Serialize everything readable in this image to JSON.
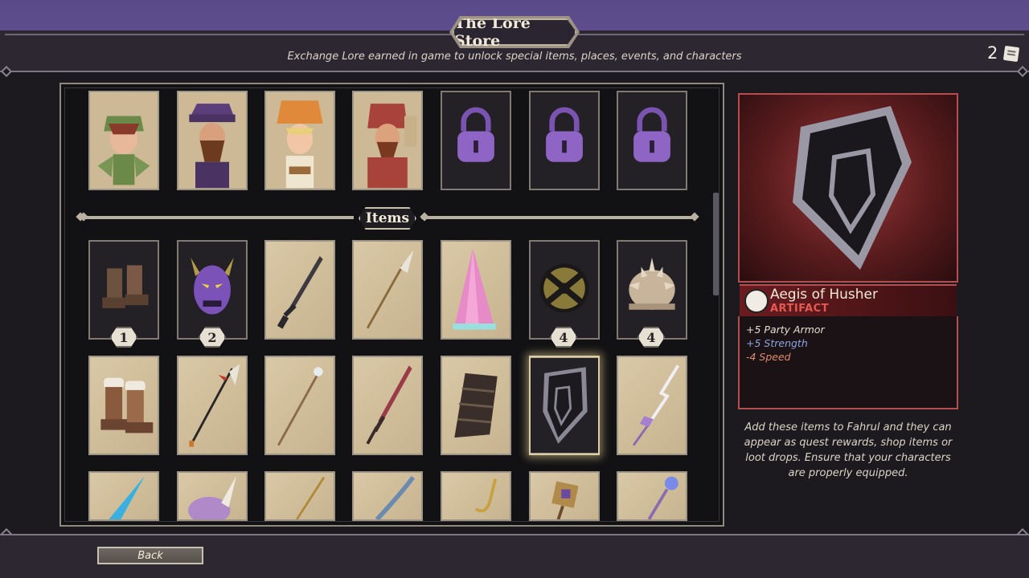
{
  "header": {
    "title": "The Lore Store",
    "subtitle": "Exchange Lore earned in game to unlock special items, places, events, and characters",
    "lore_count": "2"
  },
  "sections": {
    "items_label": "Items"
  },
  "characters": [
    {
      "name": "character-ranger-green",
      "locked": false
    },
    {
      "name": "character-bearded-purple",
      "locked": false
    },
    {
      "name": "character-blonde-orange",
      "locked": false
    },
    {
      "name": "character-red-hood",
      "locked": false
    },
    {
      "name": "locked-slot",
      "locked": true
    },
    {
      "name": "locked-slot",
      "locked": true
    },
    {
      "name": "locked-slot",
      "locked": true
    }
  ],
  "items_row1": [
    {
      "icon": "boots-icon",
      "badge": "1",
      "dark": true
    },
    {
      "icon": "demon-mask-icon",
      "badge": "2",
      "dark": true
    },
    {
      "icon": "dagger-icon",
      "badge": "",
      "dark": false
    },
    {
      "icon": "glaive-icon",
      "badge": "",
      "dark": false
    },
    {
      "icon": "crystal-cone-icon",
      "badge": "",
      "dark": false
    },
    {
      "icon": "round-shield-icon",
      "badge": "4",
      "dark": true
    },
    {
      "icon": "spiked-helm-icon",
      "badge": "4",
      "dark": true
    }
  ],
  "items_row2": [
    {
      "icon": "fur-boots-icon",
      "selected": false
    },
    {
      "icon": "halberd-icon",
      "selected": false
    },
    {
      "icon": "staff-icon",
      "selected": false
    },
    {
      "icon": "longsword-icon",
      "selected": false
    },
    {
      "icon": "gauntlet-icon",
      "selected": false
    },
    {
      "icon": "kite-shield-icon",
      "selected": true
    },
    {
      "icon": "lightning-spear-icon",
      "selected": false
    }
  ],
  "items_row3": [
    {
      "icon": "ice-shard-icon"
    },
    {
      "icon": "horned-helm-icon"
    },
    {
      "icon": "golden-spear-icon"
    },
    {
      "icon": "bow-icon"
    },
    {
      "icon": "hook-icon"
    },
    {
      "icon": "mace-icon"
    },
    {
      "icon": "orb-scepter-icon"
    }
  ],
  "detail": {
    "name": "Aegis of Husher",
    "type": "ARTIFACT",
    "stats": [
      {
        "text": "+5 Party Armor",
        "kind": "neutral"
      },
      {
        "text": "+5 Strength",
        "kind": "pos"
      },
      {
        "text": "-4 Speed",
        "kind": "neg"
      }
    ],
    "description": "Add these items to Fahrul and they can appear as quest rewards, shop items or loot drops. Ensure that your characters are properly equipped."
  },
  "footer": {
    "back_label": "Back"
  },
  "colors": {
    "accent_red": "#b54f4f",
    "parchment": "#d9c8a6",
    "stat_positive": "#8ea6e0",
    "stat_negative": "#e08a6e"
  }
}
